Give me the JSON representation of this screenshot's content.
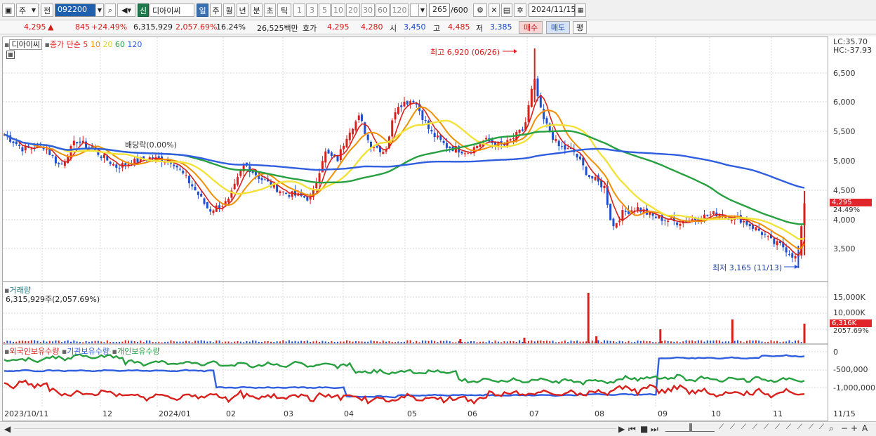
{
  "toolbar": {
    "period_week": "주",
    "prev_label": "전",
    "stock_code": "092200",
    "new_badge": "신",
    "stock_name": "디아이씨",
    "periods": [
      "일",
      "주",
      "월",
      "년",
      "분",
      "초",
      "틱"
    ],
    "active_period": "일",
    "intervals": [
      "1",
      "3",
      "5",
      "10",
      "20",
      "30",
      "60",
      "120"
    ],
    "count": "265",
    "count_total": "/600",
    "date": "2024/11/15"
  },
  "pricebar": {
    "price": "4,295",
    "change": "845",
    "change_pct": "+24.49%",
    "volume": "6,315,929",
    "volume_pct": "2,057.69%",
    "turnover": "16.24%",
    "amount": "26,525백만",
    "quote_label": "호가",
    "ask": "4,295",
    "bid": "4,280",
    "open_label": "시",
    "open": "3,450",
    "high_label": "고",
    "high": "4,485",
    "low_label": "저",
    "low": "3,385",
    "buy_label": "매수",
    "sell_label": "매도",
    "eval_label": "평"
  },
  "legend": {
    "name": "디아이씨",
    "ma_label": "종가 단순",
    "ma": [
      "5",
      "10",
      "20",
      "60",
      "120"
    ]
  },
  "annotations": {
    "high": "최고 6,920 (06/26)",
    "low": "최저 3,165 (11/13)",
    "dividend": "배당락(0.00%)"
  },
  "price_axis": {
    "lc": "LC:35.70",
    "hc": "HC:-37.93",
    "ticks": [
      "6,500",
      "6,000",
      "5,500",
      "5,000",
      "4,500",
      "4,000",
      "3,500"
    ],
    "current_tag": "4,295",
    "current_pct": "24.49%"
  },
  "volume_panel": {
    "title": "거래량",
    "info": "6,315,929주(2,057.69%)",
    "ticks": [
      "15,000K",
      "10,000K",
      "5,000K"
    ],
    "current_tag": "6,316K",
    "current_pct": "2057.69%"
  },
  "holding_panel": {
    "series": [
      "외국인보유수량",
      "기관보유수량",
      "개인보유수량"
    ],
    "ticks": [
      "0",
      "-500,000",
      "-1,000,000"
    ]
  },
  "x_axis": [
    "2023/10/11",
    "12",
    "2024/01",
    "02",
    "03",
    "04",
    "05",
    "06",
    "07",
    "08",
    "09",
    "10",
    "11",
    "11/15"
  ],
  "colors": {
    "ma5": "#d8211d",
    "ma10": "#f09000",
    "ma20": "#f2e23a",
    "ma60": "#27a040",
    "ma120": "#2f5fe0",
    "up": "#d8211d",
    "down": "#1f4fd0"
  }
}
